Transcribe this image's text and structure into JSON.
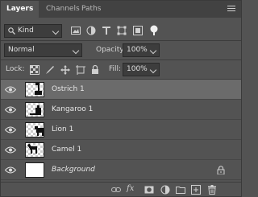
{
  "tabs": [
    {
      "label": "Layers",
      "active": true
    },
    {
      "label": "Channels",
      "active": false
    },
    {
      "label": "Paths",
      "active": false
    }
  ],
  "filter": {
    "kind_label": "Kind",
    "icons": [
      "pixel-filter-icon",
      "adjustment-filter-icon",
      "type-filter-icon",
      "shape-filter-icon",
      "smart-object-filter-icon",
      "filter-toggle-icon"
    ]
  },
  "blend": {
    "mode": "Normal",
    "opacity_label": "Opacity:",
    "opacity_value": "100%"
  },
  "lock": {
    "label": "Lock:",
    "icons": [
      "lock-transparent-icon",
      "lock-image-icon",
      "lock-position-icon",
      "lock-artboard-icon",
      "lock-all-icon"
    ],
    "fill_label": "Fill:",
    "fill_value": "100%"
  },
  "layers": [
    {
      "name": "Ostrich 1",
      "selected": true,
      "visible": true,
      "italic": false,
      "locked": false
    },
    {
      "name": "Kangaroo 1",
      "selected": false,
      "visible": true,
      "italic": false,
      "locked": false
    },
    {
      "name": "Lion 1",
      "selected": false,
      "visible": true,
      "italic": false,
      "locked": false
    },
    {
      "name": "Camel 1",
      "selected": false,
      "visible": true,
      "italic": false,
      "locked": false
    },
    {
      "name": "Background",
      "selected": false,
      "visible": true,
      "italic": true,
      "locked": true
    }
  ],
  "bottom_icons": [
    "link-layers-icon",
    "fx-icon",
    "add-mask-icon",
    "adjustment-layer-icon",
    "new-group-icon",
    "new-layer-icon",
    "delete-layer-icon"
  ],
  "bottom_fx_text": "fx",
  "colors": {
    "panel": "#535353",
    "tabbar": "#424242",
    "selected_row": "#6b6b6b",
    "field": "#3d3d3d"
  }
}
